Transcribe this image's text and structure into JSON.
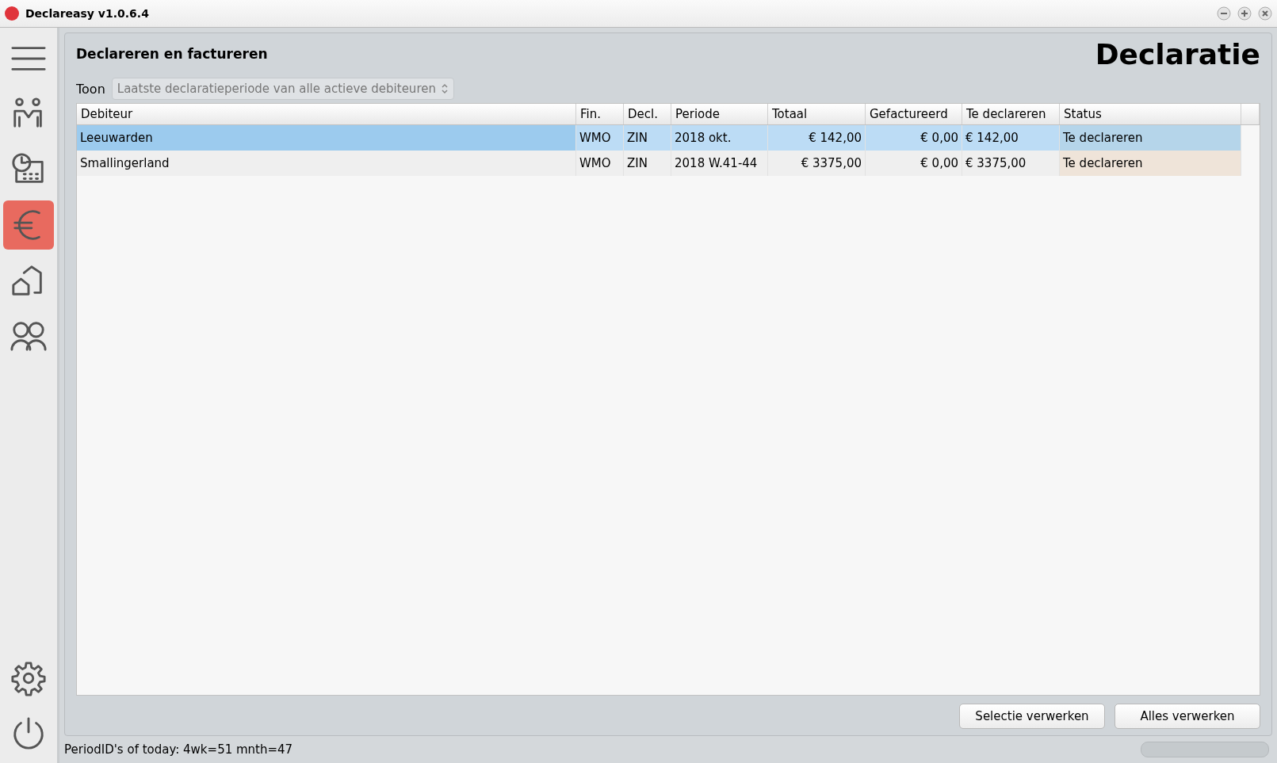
{
  "window": {
    "title": "Declareasy v1.0.6.4"
  },
  "sidebar": {
    "items": [
      {
        "selected": false
      },
      {
        "selected": false
      },
      {
        "selected": false
      },
      {
        "selected": true
      },
      {
        "selected": false
      },
      {
        "selected": false
      }
    ],
    "bottom_items": [
      {
        "selected": false
      },
      {
        "selected": false
      }
    ]
  },
  "panel": {
    "heading": "Declareren en factureren",
    "page_title": "Declaratie"
  },
  "filter": {
    "label": "Toon",
    "value": "Laatste declaratieperiode van alle actieve debiteuren"
  },
  "table": {
    "columns": [
      {
        "label": "Debiteur"
      },
      {
        "label": "Fin."
      },
      {
        "label": "Decl."
      },
      {
        "label": "Periode"
      },
      {
        "label": "Totaal"
      },
      {
        "label": "Gefactureerd"
      },
      {
        "label": "Te declareren"
      },
      {
        "label": "Status"
      }
    ],
    "rows": [
      {
        "selected": true,
        "cells": [
          "Leeuwarden",
          "WMO",
          "ZIN",
          "2018 okt.",
          "€ 142,00",
          "€ 0,00",
          "€ 142,00",
          "Te declareren"
        ]
      },
      {
        "selected": false,
        "cells": [
          "Smallingerland",
          "WMO",
          "ZIN",
          "2018 W.41-44",
          "€ 3375,00",
          "€ 0,00",
          "€ 3375,00",
          "Te declareren"
        ]
      }
    ]
  },
  "buttons": [
    "Selectie verwerken",
    "Alles verwerken"
  ],
  "status_bar": {
    "text": "PeriodID's of today: 4wk=51 mnth=47"
  }
}
